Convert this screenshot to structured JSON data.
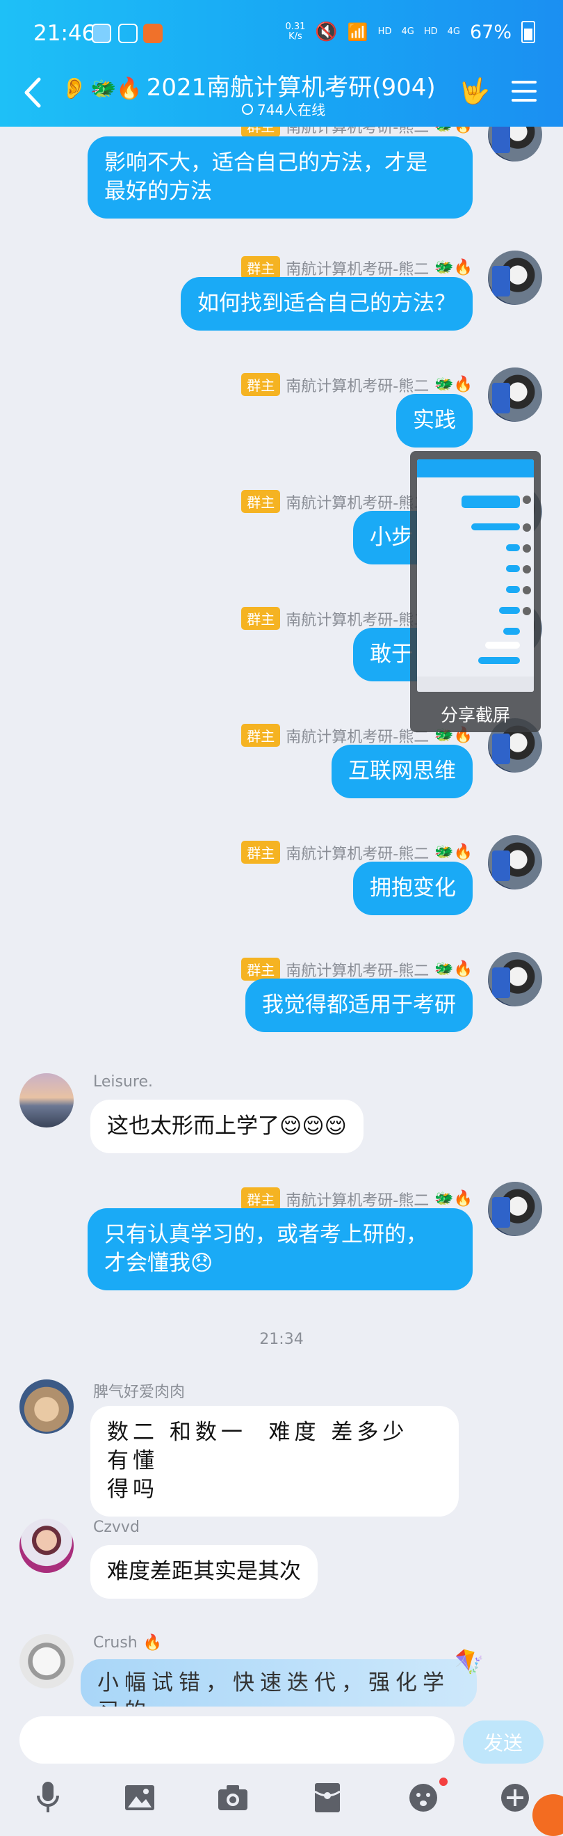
{
  "status_bar": {
    "time": "21:46",
    "net_speed_top": "0.31",
    "net_speed_bottom": "K/s",
    "hd1": "HD",
    "sig1": "4G",
    "hd2": "HD",
    "sig2": "4G",
    "battery": "67%"
  },
  "header": {
    "title_emoji": "🐲🔥",
    "title": "2021南航计算机考研(904)",
    "online": "744人在线"
  },
  "messages": [
    {
      "side": "right",
      "badge": "群主",
      "name": "南航计算机考研-熊二",
      "name_emoji": "🐲🔥",
      "text": "影响不大，适合自己的方法，才是\n最好的方法"
    },
    {
      "side": "right",
      "badge": "群主",
      "name": "南航计算机考研-熊二",
      "name_emoji": "🐲🔥",
      "text": "如何找到适合自己的方法？"
    },
    {
      "side": "right",
      "badge": "群主",
      "name": "南航计算机考研-熊二",
      "name_emoji": "🐲🔥",
      "text": "实践"
    },
    {
      "side": "right",
      "badge": "群主",
      "name": "南航计算机考研-熊二",
      "name_emoji": "🐲🔥",
      "text": "小步"
    },
    {
      "side": "right",
      "badge": "群主",
      "name": "南航计算机考研-熊二",
      "name_emoji": "🐲🔥",
      "text": "敢于"
    },
    {
      "side": "right",
      "badge": "群主",
      "name": "南航计算机考研-熊二",
      "name_emoji": "🐲🔥",
      "text": "互联网思维"
    },
    {
      "side": "right",
      "badge": "群主",
      "name": "南航计算机考研-熊二",
      "name_emoji": "🐲🔥",
      "text": "拥抱变化"
    },
    {
      "side": "right",
      "badge": "群主",
      "name": "南航计算机考研-熊二",
      "name_emoji": "🐲🔥",
      "text": "我觉得都适用于考研"
    },
    {
      "side": "left",
      "name": "Leisure.",
      "text": "这也太形而上学了😌😌😌"
    },
    {
      "side": "right",
      "badge": "群主",
      "name": "南航计算机考研-熊二",
      "name_emoji": "🐲🔥",
      "text": "只有认真学习的，或者考上研的，\n才会懂我😞"
    },
    {
      "side": "left",
      "name": "脾气好爱肉肉",
      "text": "数二 和数一  难度 差多少  有懂\n得吗"
    },
    {
      "side": "left",
      "name": "Czvvd",
      "text": "难度差距其实是其次"
    },
    {
      "side": "left",
      "name": "Crush",
      "name_emoji": "🔥",
      "text": "小幅试错，快速迭代，强化学习的"
    }
  ],
  "timestamp": "21:34",
  "share_overlay": {
    "label": "分享截屏"
  },
  "input": {
    "placeholder": "",
    "send_label": "发送"
  },
  "colors": {
    "header_start": "#1ec0f7",
    "header_end": "#1b8ff2",
    "bubble_self": "#1aaaf6",
    "badge": "#f5b322"
  },
  "toolbar_icons": [
    "mic-icon",
    "image-icon",
    "camera-icon",
    "red-packet-icon",
    "emoji-icon",
    "plus-icon"
  ]
}
